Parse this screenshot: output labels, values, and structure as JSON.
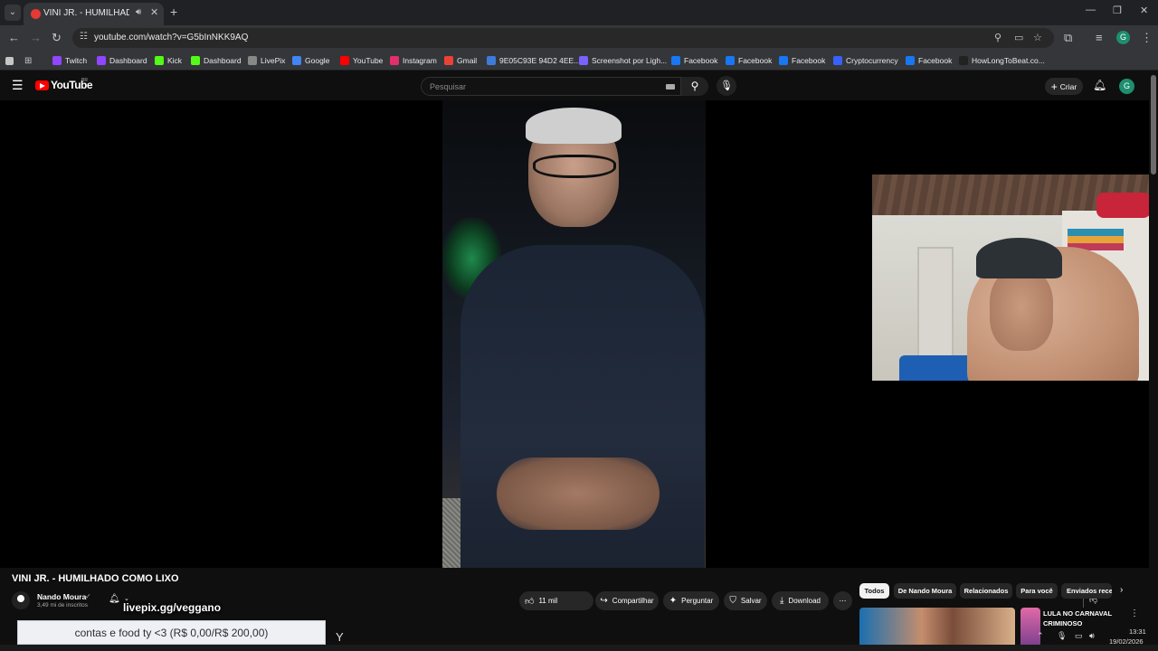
{
  "browser": {
    "tab_title": "VINI JR. - HUMILHADO COMO LIXO - YouTube",
    "url": "youtube.com/watch?v=G5bInNKK9AQ",
    "profile_initial": "G"
  },
  "bookmarks": [
    {
      "label": "Twitch",
      "icon": "twitch-icon",
      "color": "#9146ff"
    },
    {
      "label": "Dashboard",
      "icon": "twitch-icon",
      "color": "#9146ff"
    },
    {
      "label": "Kick",
      "icon": "kick-icon",
      "color": "#53fc18"
    },
    {
      "label": "Dashboard",
      "icon": "kick-icon",
      "color": "#53fc18"
    },
    {
      "label": "LivePix",
      "icon": "livepix-icon",
      "color": "#888888"
    },
    {
      "label": "Google",
      "icon": "google-icon",
      "color": "#4285f4"
    },
    {
      "label": "YouTube",
      "icon": "youtube-icon",
      "color": "#ff0000"
    },
    {
      "label": "Instagram",
      "icon": "instagram-icon",
      "color": "#e1306c"
    },
    {
      "label": "Gmail",
      "icon": "gmail-icon",
      "color": "#ea4335"
    },
    {
      "label": "9E05C93E 94D2 4EE...",
      "icon": "doc-icon",
      "color": "#3d7bd8"
    },
    {
      "label": "Screenshot por Ligh...",
      "icon": "feather-icon",
      "color": "#7b61ff"
    },
    {
      "label": "Facebook",
      "icon": "facebook-icon",
      "color": "#1877f2"
    },
    {
      "label": "Facebook",
      "icon": "facebook-icon",
      "color": "#1877f2"
    },
    {
      "label": "Facebook",
      "icon": "facebook-icon",
      "color": "#1877f2"
    },
    {
      "label": "Cryptocurrency",
      "icon": "crypto-icon",
      "color": "#3861fb"
    },
    {
      "label": "Facebook",
      "icon": "facebook-icon",
      "color": "#1877f2"
    },
    {
      "label": "HowLongToBeat.co...",
      "icon": "hltb-icon",
      "color": "#222222"
    }
  ],
  "youtube": {
    "logo_text": "YouTube",
    "country_code": "BR",
    "search_placeholder": "Pesquisar",
    "create_label": "Criar",
    "avatar_initial": "G"
  },
  "video": {
    "title": "VINI JR. - HUMILHADO COMO LIXO",
    "channel_name": "Nando Moura",
    "subscribers": "3,49 mi de inscritos",
    "likes": "11 mil",
    "actions": {
      "share": "Compartilhar",
      "ask": "Perguntar",
      "save": "Salvar",
      "download": "Download"
    }
  },
  "chips": [
    "Todos",
    "De Nando Moura",
    "Relacionados",
    "Para você",
    "Enviados rece"
  ],
  "recommendation": {
    "title": "LULA NO CARNAVAL CRIMINOSO"
  },
  "overlay": {
    "livepix": "livepix.gg/veggano",
    "donation_goal": "contas e food ty <3 (R$ 0,00/R$ 200,00)"
  },
  "system": {
    "time": "13:31",
    "date": "19/02/2026"
  },
  "colors": {
    "background": "#0f0f0f",
    "youtube_red": "#ff0000",
    "chip_active": "#f1f1f1"
  }
}
